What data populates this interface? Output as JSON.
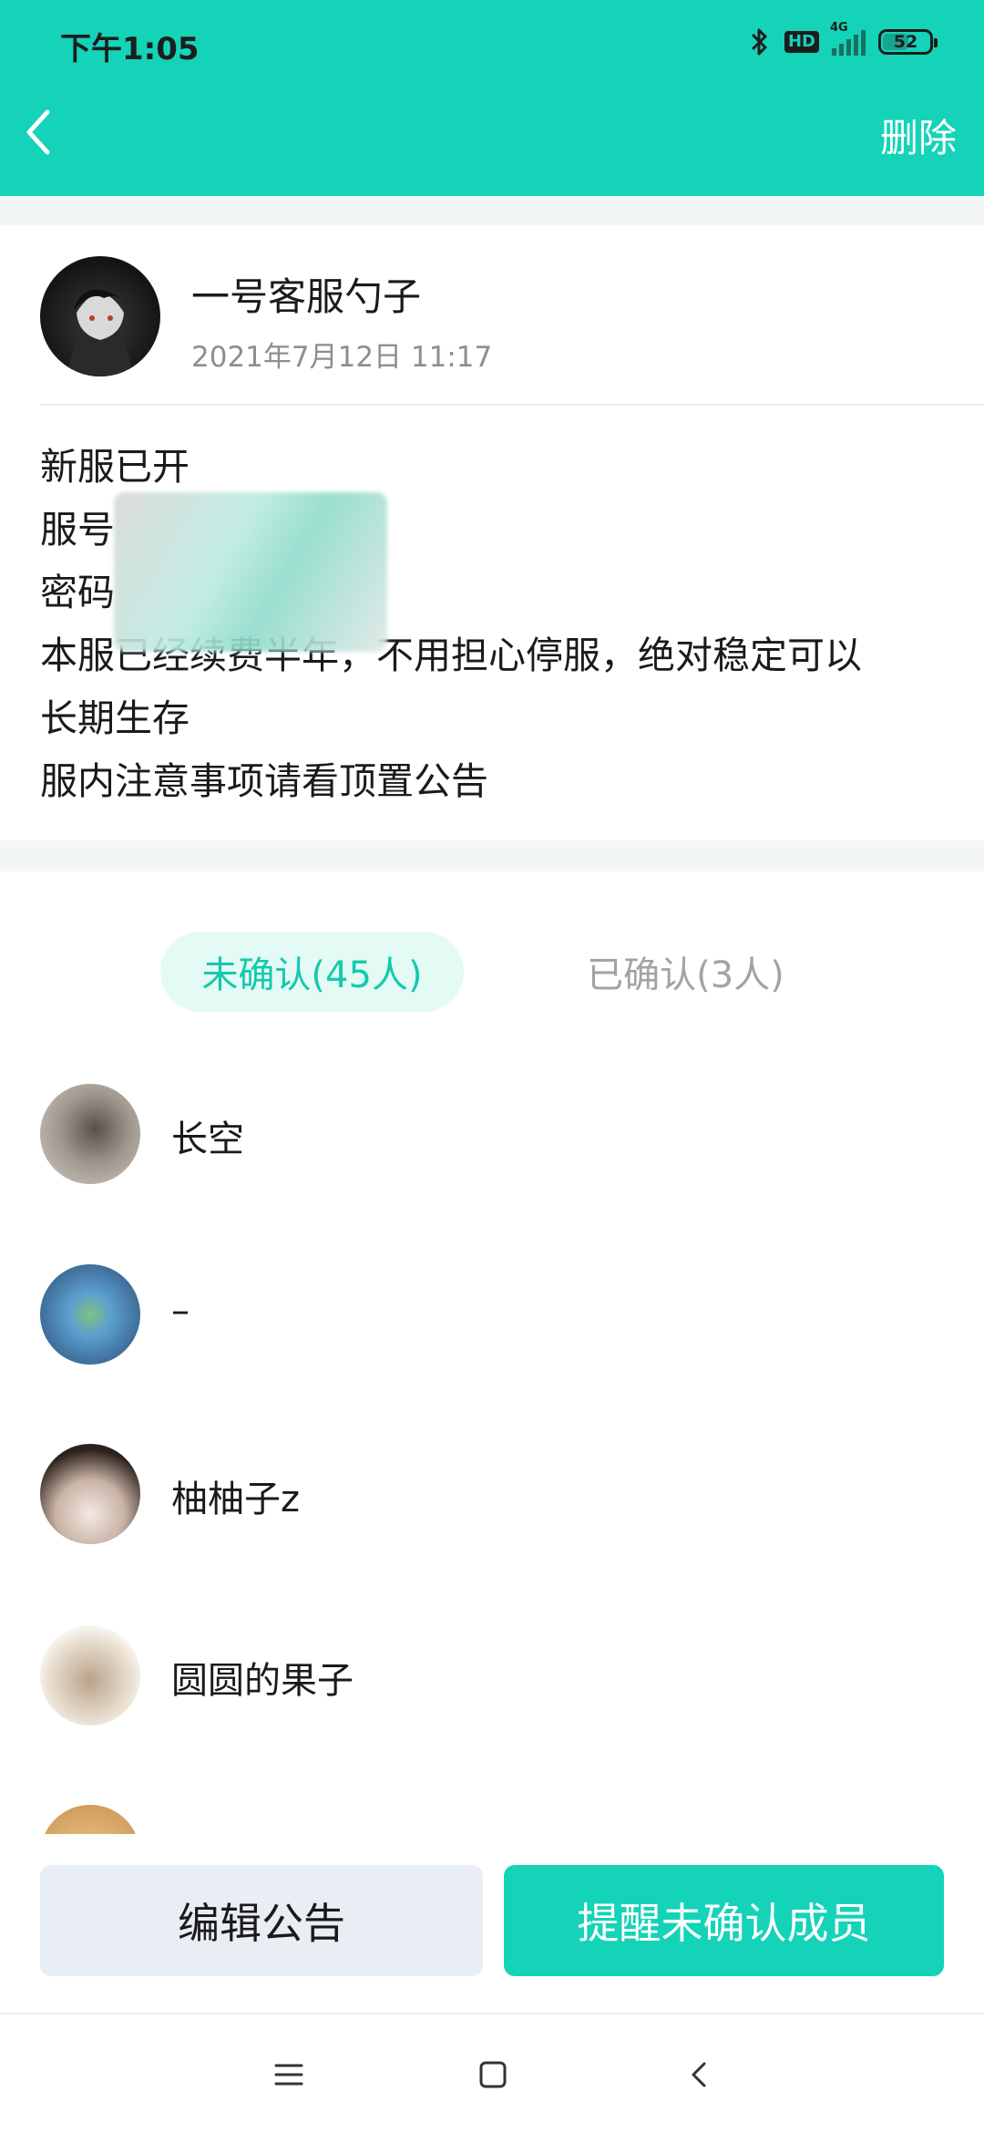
{
  "status_bar": {
    "time": "下午1:05",
    "hd_label": "HD",
    "network": "4G",
    "battery": "52"
  },
  "header": {
    "back_icon": "chevron-left-icon",
    "delete_label": "删除",
    "accent_color": "#14d3b8"
  },
  "post": {
    "author": "一号客服勺子",
    "time": "2021年7月12日 11:17",
    "lines": [
      "新服已开",
      "服号",
      "密码",
      "本服已经续费半年，不用担心停服，绝对稳定可以",
      "长期生存",
      "服内注意事项请看顶置公告"
    ]
  },
  "tabs": {
    "unconfirmed": "未确认(45人)",
    "confirmed": "已确认(3人)"
  },
  "members": [
    {
      "name": "长空"
    },
    {
      "name": "–"
    },
    {
      "name": "柚柚子z"
    },
    {
      "name": "圆圆的果子"
    },
    {
      "name": ""
    }
  ],
  "actions": {
    "edit_label": "编辑公告",
    "remind_label": "提醒未确认成员"
  },
  "nav": {
    "menu_icon": "menu-icon",
    "home_icon": "home-icon",
    "back_icon": "back-icon"
  }
}
